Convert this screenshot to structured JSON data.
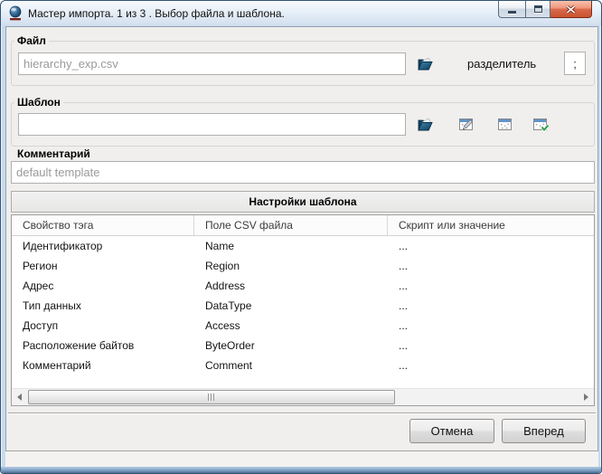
{
  "window": {
    "title": "Мастер импорта. 1 из 3 . Выбор файла и шаблона."
  },
  "file_section": {
    "label": "Файл",
    "filename": "hierarchy_exp.csv",
    "delimiter_label": "разделитель",
    "delimiter": ";"
  },
  "template_section": {
    "label": "Шаблон",
    "value": ""
  },
  "comment_section": {
    "label": "Комментарий",
    "value": "default template"
  },
  "settings": {
    "header": "Настройки шаблона",
    "columns": [
      "Свойство тэга",
      "Поле CSV файла",
      "Скрипт или значение"
    ],
    "rows": [
      {
        "property": "Идентификатор",
        "csv_field": "Name",
        "script": "..."
      },
      {
        "property": "Регион",
        "csv_field": "Region",
        "script": "..."
      },
      {
        "property": "Адрес",
        "csv_field": "Address",
        "script": "..."
      },
      {
        "property": "Тип данных",
        "csv_field": "DataType",
        "script": "..."
      },
      {
        "property": "Доступ",
        "csv_field": "Access",
        "script": "..."
      },
      {
        "property": "Расположение байтов",
        "csv_field": "ByteOrder",
        "script": "..."
      },
      {
        "property": "Комментарий",
        "csv_field": "Comment",
        "script": "..."
      }
    ]
  },
  "footer": {
    "cancel_label": "Отмена",
    "next_label": "Вперед"
  },
  "icons": {
    "app": "import-wizard-logo",
    "minimize": "minimize-dash",
    "maximize": "maximize-square",
    "close": "close-x",
    "open_file": "open-folder",
    "template_open": "open-folder",
    "template_edit": "window-with-pencil",
    "template_blank": "window-grid",
    "template_apply": "window-with-green-check",
    "scroll_left": "triangle-left",
    "scroll_right": "triangle-right"
  },
  "colors": {
    "frame": "#c9daee",
    "client_bg": "#f0efed",
    "close_button": "#d96a4c",
    "input_text": "#9a9a9a",
    "folder_icon": "#1d5d80",
    "check_icon": "#2da04a"
  }
}
